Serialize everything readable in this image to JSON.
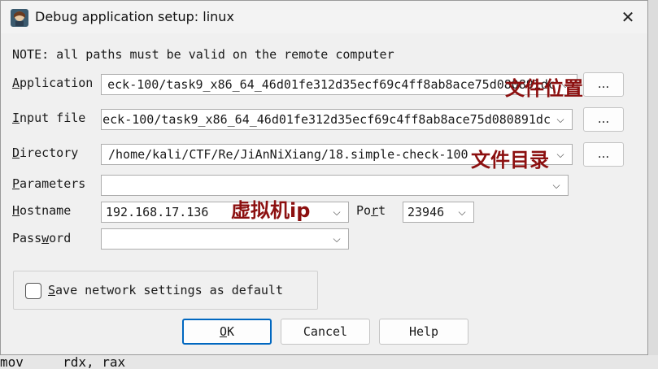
{
  "window": {
    "title": "Debug application setup: linux",
    "close_glyph": "✕"
  },
  "note": "NOTE: all paths must be valid on the remote computer",
  "fields": {
    "application": {
      "label_u": "A",
      "label_rest": "pplication",
      "value": "eck-100/task9_x86_64_46d01fe312d35ecf69c4ff8ab8ace75d080891dc"
    },
    "input_file": {
      "label_u": "I",
      "label_rest": "nput file",
      "value": "eck-100/task9_x86_64_46d01fe312d35ecf69c4ff8ab8ace75d080891dc"
    },
    "directory": {
      "label_u": "D",
      "label_rest": "irectory",
      "value": "/home/kali/CTF/Re/JiAnNiXiang/18.simple-check-100"
    },
    "parameters": {
      "label_u": "P",
      "label_rest": "arameters",
      "value": ""
    },
    "hostname": {
      "label_u": "H",
      "label_rest": "ostname",
      "value": "192.168.17.136"
    },
    "port": {
      "label_pre": "Po",
      "label_u": "r",
      "label_rest": "t",
      "value": "23946"
    },
    "password": {
      "label_pre": "Pass",
      "label_u": "w",
      "label_rest": "ord",
      "value": ""
    }
  },
  "browse_label": "...",
  "chevron": "⌵",
  "save_default": {
    "label_u": "S",
    "label_rest": "ave network settings as default",
    "checked": false
  },
  "buttons": {
    "ok_u": "O",
    "ok_rest": "K",
    "cancel": "Cancel",
    "help": "Help"
  },
  "annotations": {
    "file_location": "文件位置",
    "file_directory": "文件目录",
    "vm_ip": "虚拟机ip"
  },
  "background_code": "mov     rdx, rax",
  "colors": {
    "accent": "#0067c0",
    "annotation": "#8c1010",
    "background": "#f0f0f0"
  }
}
